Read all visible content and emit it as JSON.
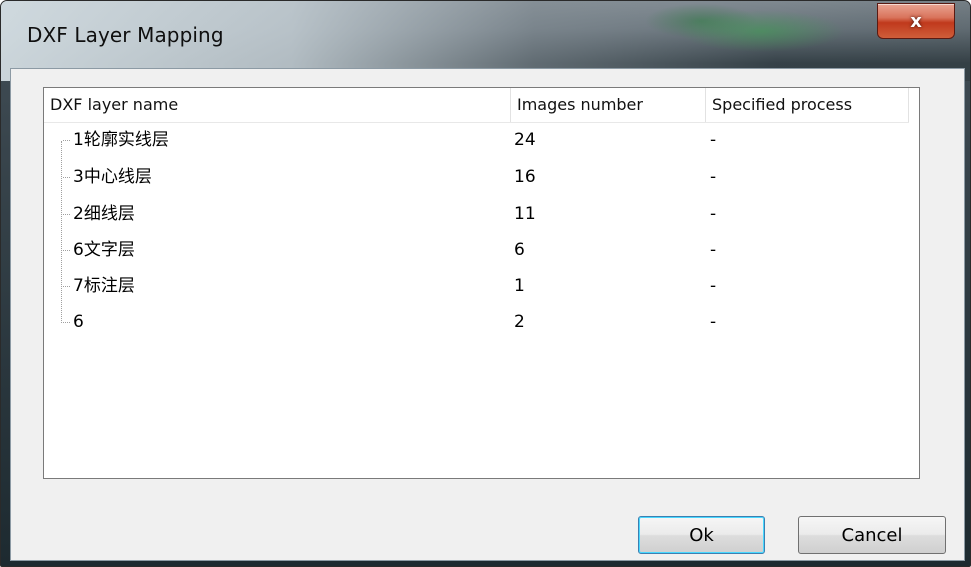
{
  "window": {
    "title": "DXF Layer Mapping",
    "close_glyph": "x"
  },
  "list": {
    "columns": [
      "DXF layer name",
      "Images number",
      "Specified process"
    ],
    "rows": [
      {
        "name": "1轮廓实线层",
        "images": "24",
        "process": "-"
      },
      {
        "name": "3中心线层",
        "images": "16",
        "process": "-"
      },
      {
        "name": "2细线层",
        "images": "11",
        "process": "-"
      },
      {
        "name": "6文字层",
        "images": "6",
        "process": "-"
      },
      {
        "name": "7标注层",
        "images": "1",
        "process": "-"
      },
      {
        "name": "6",
        "images": "2",
        "process": "-"
      }
    ]
  },
  "buttons": {
    "ok_label": "Ok",
    "cancel_label": "Cancel"
  }
}
